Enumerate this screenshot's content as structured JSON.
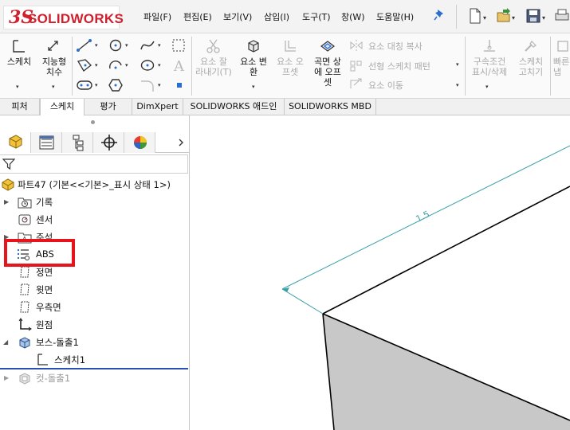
{
  "app": {
    "logo_prefix": "3S",
    "logo_text": "SOLIDWORKS"
  },
  "menu": [
    "파일(F)",
    "편집(E)",
    "보기(V)",
    "삽입(I)",
    "도구(T)",
    "창(W)",
    "도움말(H)"
  ],
  "toolbar_icons": [
    "new-document-icon",
    "open-icon",
    "save-icon",
    "print-icon"
  ],
  "ribbon": {
    "sketch": "스케치",
    "smart_dimension": [
      "지능형",
      "치수"
    ],
    "trim": [
      "요소 잘",
      "라내기(T)"
    ],
    "convert": [
      "요소 변",
      "환"
    ],
    "offset": [
      "요소 오",
      "프셋"
    ],
    "surface_offset": [
      "곡면 상",
      "에 오프",
      "셋"
    ],
    "mirror": "요소 대칭 복사",
    "linear_pattern": "선형 스케치 패턴",
    "move": "요소 이동",
    "relations": [
      "구속조건",
      "표시/삭제"
    ],
    "repair": [
      "스케치",
      "고치기"
    ],
    "quick_snaps": [
      "빠른",
      "냅"
    ]
  },
  "tabs": [
    "피처",
    "스케치",
    "평가",
    "DimXpert",
    "SOLIDWORKS 애드인",
    "SOLIDWORKS MBD"
  ],
  "active_tab": "스케치",
  "tree": {
    "root": "파트47  (기본<<기본>_표시 상태 1>)",
    "items": [
      {
        "label": "기록",
        "expandable": true
      },
      {
        "label": "센서",
        "expandable": false
      },
      {
        "label": "주석",
        "expandable": true
      },
      {
        "label": "ABS",
        "expandable": false
      },
      {
        "label": "정면",
        "expandable": false
      },
      {
        "label": "윗면",
        "expandable": false
      },
      {
        "label": "우측면",
        "expandable": false
      },
      {
        "label": "원점",
        "expandable": false
      },
      {
        "label": "보스-돌출1",
        "expandable": true,
        "expanded": true
      },
      {
        "label": "스케치1",
        "expandable": false
      },
      {
        "label": "컷-돌출1",
        "expandable": true,
        "suppressed": true
      }
    ]
  },
  "viewport": {
    "dimension_label": "1.5"
  },
  "colors": {
    "brand": "#d0202e",
    "highlight": "#e8141b",
    "dimension": "#3aa0a8",
    "rollback": "#2d4fb3",
    "face": "#c8c8c8"
  }
}
